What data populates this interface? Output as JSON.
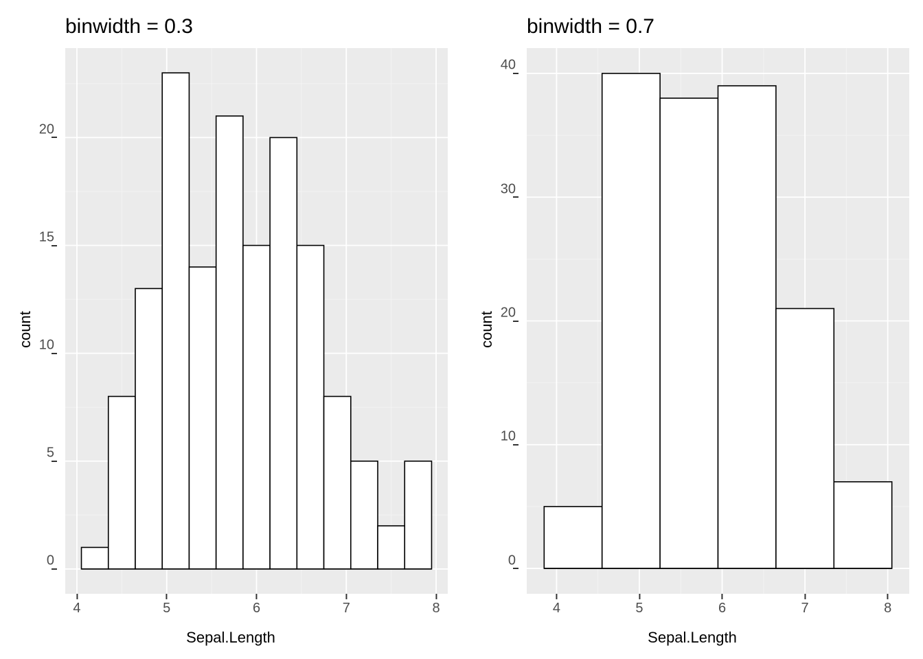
{
  "chart_data": [
    {
      "type": "bar",
      "title": "binwidth = 0.3",
      "xlabel": "Sepal.Length",
      "ylabel": "count",
      "binwidth": 0.3,
      "bins_start": 4.05,
      "categories": [
        4.2,
        4.5,
        4.8,
        5.1,
        5.4,
        5.7,
        6.0,
        6.3,
        6.6,
        6.9,
        7.2,
        7.5,
        7.8
      ],
      "values": [
        1,
        8,
        13,
        23,
        14,
        21,
        15,
        20,
        15,
        8,
        5,
        2,
        5
      ],
      "xlim": [
        3.87,
        8.13
      ],
      "ylim": [
        -1.15,
        24.15
      ],
      "xticks": [
        4,
        5,
        6,
        7,
        8
      ],
      "yticks": [
        0,
        5,
        10,
        15,
        20
      ],
      "xticks_minor": [
        4.5,
        5.5,
        6.5,
        7.5
      ],
      "yticks_minor": [
        2.5,
        7.5,
        12.5,
        17.5,
        22.5
      ]
    },
    {
      "type": "bar",
      "title": "binwidth = 0.7",
      "xlabel": "Sepal.Length",
      "ylabel": "count",
      "binwidth": 0.7,
      "bins_start": 3.85,
      "categories": [
        4.2,
        4.9,
        5.6,
        6.3,
        7.0,
        7.7
      ],
      "values": [
        5,
        40,
        38,
        39,
        21,
        7
      ],
      "xlim": [
        3.64,
        8.26
      ],
      "ylim": [
        -2.05,
        42.05
      ],
      "xticks": [
        4,
        5,
        6,
        7,
        8
      ],
      "yticks": [
        0,
        10,
        20,
        30,
        40
      ],
      "xticks_minor": [
        4.5,
        5.5,
        6.5,
        7.5
      ],
      "yticks_minor": [
        5,
        15,
        25,
        35
      ]
    }
  ]
}
